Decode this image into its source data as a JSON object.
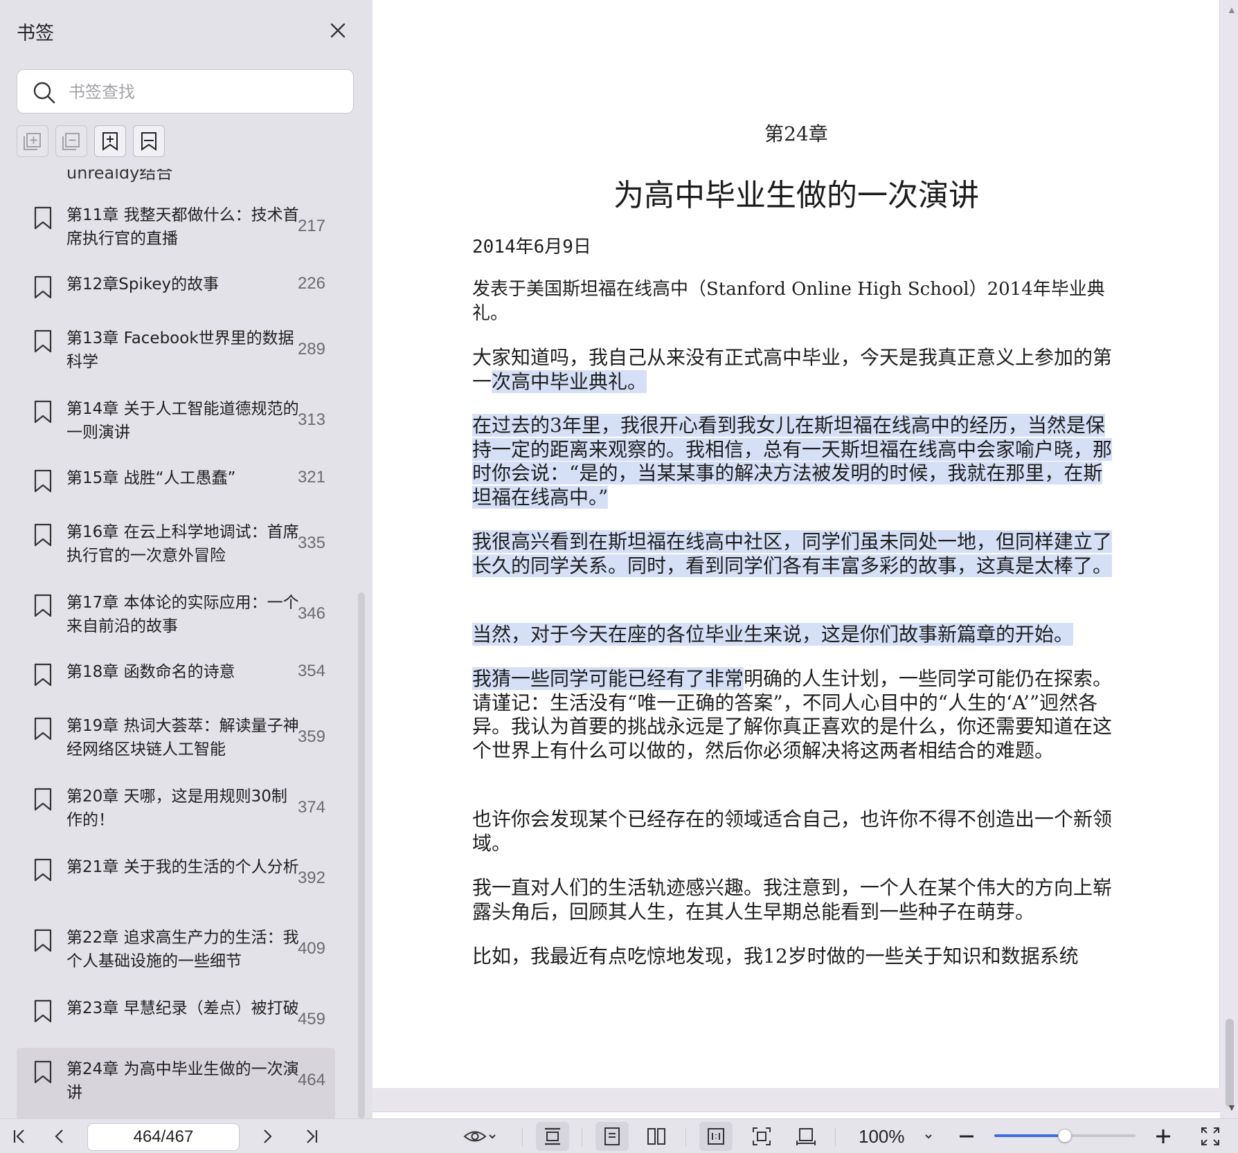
{
  "sidebar": {
    "title": "书签",
    "search_placeholder": "书签查找",
    "partial_item": "unrealdy结合",
    "items": [
      {
        "title": "第11章 我整天都做什么：技术首席执行官的直播",
        "page": "217"
      },
      {
        "title": "第12章Spikey的故事",
        "page": "226"
      },
      {
        "title": "第13章 Facebook世界里的数据科学",
        "page": "289"
      },
      {
        "title": "第14章 关于人工智能道德规范的一则演讲",
        "page": "313"
      },
      {
        "title": "第15章 战胜“人工愚蠢”",
        "page": "321"
      },
      {
        "title": "第16章 在云上科学地调试：首席执行官的一次意外冒险",
        "page": "335"
      },
      {
        "title": "第17章 本体论的实际应用：一个来自前沿的故事",
        "page": "346"
      },
      {
        "title": "第18章 函数命名的诗意",
        "page": "354"
      },
      {
        "title": "第19章 热词大荟萃：解读量子神经网络区块链人工智能",
        "page": "359"
      },
      {
        "title": "第20章 天哪，这是用规则30制作的！",
        "page": "374"
      },
      {
        "title": "第21章 关于我的生活的个人分析",
        "page": "392"
      },
      {
        "title": "第22章 追求高生产力的生活：我个人基础设施的一些细节",
        "page": "409"
      },
      {
        "title": "第23章 早慧纪录（差点）被打破",
        "page": "459"
      },
      {
        "title": "第24章 为高中毕业生做的一次演讲",
        "page": "464"
      }
    ]
  },
  "document": {
    "chapter_number": "第24章",
    "chapter_title": "为高中毕业生做的一次演讲",
    "date": "2014年6月9日",
    "intro": "发表于美国斯坦福在线高中（Stanford Online High School）2014年毕业典礼。",
    "p1_plain": "大家知道吗，我自己从来没有正式高中毕业，今天是我真正意义上参加的第一",
    "p1_hl": "次高中毕业典礼。",
    "p2": "在过去的3年里，我很开心看到我女儿在斯坦福在线高中的经历，当然是保持一定的距离来观察的。我相信，总有一天斯坦福在线高中会家喻户晓，那时你会说：“是的，当某某事的解决方法被发明的时候，我就在那里，在斯坦福在线高中。”",
    "p3": "我很高兴看到在斯坦福在线高中社区，同学们虽未同处一地，但同样建立了长久的同学关系。同时，看到同学们各有丰富多彩的故事，这真是太棒了。",
    "p4": "当然，对于今天在座的各位毕业生来说，这是你们故事新篇章的开始。",
    "p5_hl": "我猜一些同学可能已经有了非常",
    "p5_plain": "明确的人生计划，一些同学可能仍在探索。请谨记：生活没有“唯一正确的答案”，不同人心目中的“人生的‘A’”迥然各异。我认为首要的挑战永远是了解你真正喜欢的是什么，你还需要知道在这个世界上有什么可以做的，然后你必须解决将这两者相结合的难题。",
    "p6": "也许你会发现某个已经存在的领域适合自己，也许你不得不创造出一个新领域。",
    "p7": "我一直对人们的生活轨迹感兴趣。我注意到，一个人在某个伟大的方向上崭露头角后，回顾其人生，在其人生早期总能看到一些种子在萌芽。",
    "p8": "比如，我最近有点吃惊地发现，我12岁时做的一些关于知识和数据系统"
  },
  "toolbar": {
    "page_indicator": "464/467",
    "zoom": "100%",
    "zoom_slider_fraction": 0.5
  },
  "colors": {
    "accent": "#3c6ee0",
    "highlight": "#d5e0f7"
  }
}
